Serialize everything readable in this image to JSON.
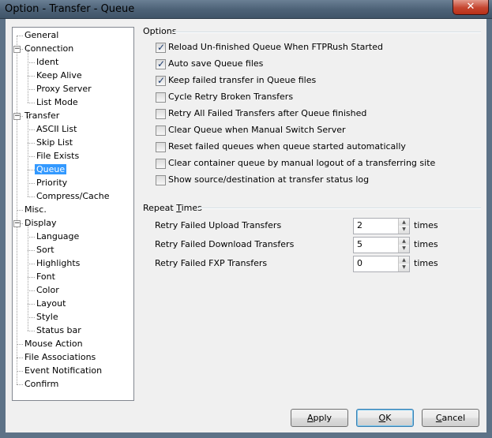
{
  "window": {
    "title": "Option - Transfer - Queue",
    "close_label": "✕"
  },
  "tree": {
    "items": [
      {
        "label": "General",
        "level": 0
      },
      {
        "label": "Connection",
        "level": 0
      },
      {
        "label": "Ident",
        "level": 1
      },
      {
        "label": "Keep Alive",
        "level": 1
      },
      {
        "label": "Proxy Server",
        "level": 1
      },
      {
        "label": "List Mode",
        "level": 1
      },
      {
        "label": "Transfer",
        "level": 0
      },
      {
        "label": "ASCII List",
        "level": 1
      },
      {
        "label": "Skip List",
        "level": 1
      },
      {
        "label": "File Exists",
        "level": 1
      },
      {
        "label": "Queue",
        "level": 1
      },
      {
        "label": "Priority",
        "level": 1
      },
      {
        "label": "Compress/Cache",
        "level": 1
      },
      {
        "label": "Misc.",
        "level": 0
      },
      {
        "label": "Display",
        "level": 0
      },
      {
        "label": "Language",
        "level": 1
      },
      {
        "label": "Sort",
        "level": 1
      },
      {
        "label": "Highlights",
        "level": 1
      },
      {
        "label": "Font",
        "level": 1
      },
      {
        "label": "Color",
        "level": 1
      },
      {
        "label": "Layout",
        "level": 1
      },
      {
        "label": "Style",
        "level": 1
      },
      {
        "label": "Status bar",
        "level": 1
      },
      {
        "label": "Mouse Action",
        "level": 0
      },
      {
        "label": "File Associations",
        "level": 0
      },
      {
        "label": "Event Notification",
        "level": 0
      },
      {
        "label": "Confirm",
        "level": 0
      }
    ],
    "expander_symbol": "−"
  },
  "options": {
    "title": "Options",
    "items": [
      {
        "label": "Reload Un-finished Queue When FTPRush Started",
        "checked": true
      },
      {
        "label": "Auto save Queue files",
        "checked": true
      },
      {
        "label": "Keep failed transfer in Queue files",
        "checked": true
      },
      {
        "label": "Cycle Retry Broken Transfers",
        "checked": false
      },
      {
        "label": "Retry All Failed Transfers after Queue finished",
        "checked": false
      },
      {
        "label": "Clear Queue when Manual Switch Server",
        "checked": false
      },
      {
        "label": "Reset failed queues when queue started automatically",
        "checked": false
      },
      {
        "label": "Clear container queue by manual logout of a transferring site",
        "checked": false
      },
      {
        "label": "Show source/destination at transfer status log",
        "checked": false
      }
    ]
  },
  "repeat_times": {
    "title_prefix": "Repeat ",
    "title_underlined": "T",
    "title_suffix": "imes",
    "fields": [
      {
        "label": "Retry Failed Upload Transfers",
        "value": "2",
        "unit": "times"
      },
      {
        "label": "Retry Failed Download Transfers",
        "value": "5",
        "unit": "times"
      },
      {
        "label": "Retry Failed FXP Transfers",
        "value": "0",
        "unit": "times"
      }
    ]
  },
  "buttons": {
    "apply": {
      "underlined": "A",
      "rest": "pply"
    },
    "ok": {
      "underlined": "O",
      "rest": "K"
    },
    "cancel": {
      "underlined": "C",
      "rest": "ancel"
    }
  },
  "spinner": {
    "up": "▲",
    "down": "▼"
  }
}
